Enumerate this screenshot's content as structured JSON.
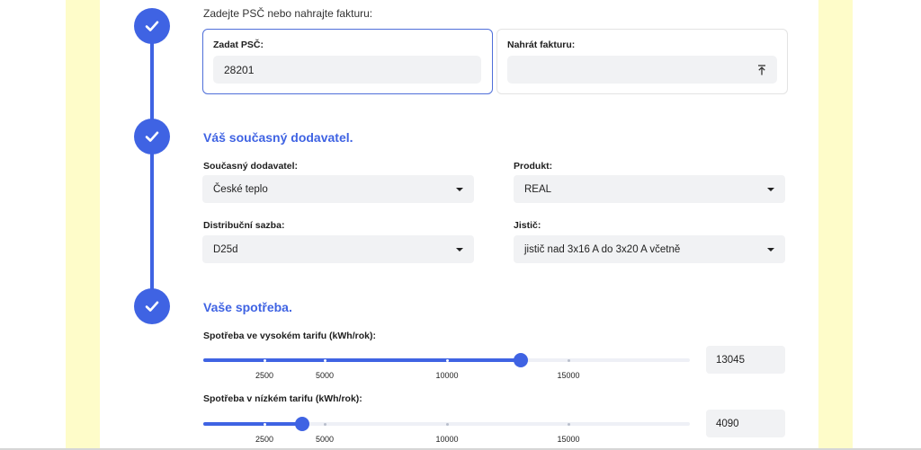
{
  "colors": {
    "accent": "#3f63e3",
    "strip": "#fefcc9",
    "input_bg": "#f1f2f4"
  },
  "icons": {
    "step_check": "check-icon",
    "upload": "upload-icon",
    "dropdown": "caret-down-icon"
  },
  "step1": {
    "hint": "Zadejte PSČ nebo nahrajte fakturu:",
    "zip_card": {
      "label": "Zadat PSČ:",
      "value": "28201"
    },
    "invoice_card": {
      "label": "Nahrát fakturu:",
      "value": ""
    }
  },
  "step2": {
    "title": "Váš současný dodavatel.",
    "supplier": {
      "label": "Současný dodavatel:",
      "value": "České teplo"
    },
    "product": {
      "label": "Produkt:",
      "value": "REAL"
    },
    "tariff": {
      "label": "Distribuční sazba:",
      "value": "D25d"
    },
    "breaker": {
      "label": "Jistič:",
      "value": "jistič nad 3x16 A do 3x20 A včetně"
    }
  },
  "step3": {
    "title": "Vaše spotřeba.",
    "high": {
      "label": "Spotřeba ve vysokém tarifu (kWh/rok):",
      "value": "13045",
      "level": 0.652,
      "ticks": [
        "2500",
        "5000",
        "10000",
        "15000"
      ]
    },
    "low": {
      "label": "Spotřeba v nízkém tarifu (kWh/rok):",
      "value": "4090",
      "level": 0.204,
      "ticks": [
        "2500",
        "5000",
        "10000",
        "15000"
      ]
    }
  }
}
